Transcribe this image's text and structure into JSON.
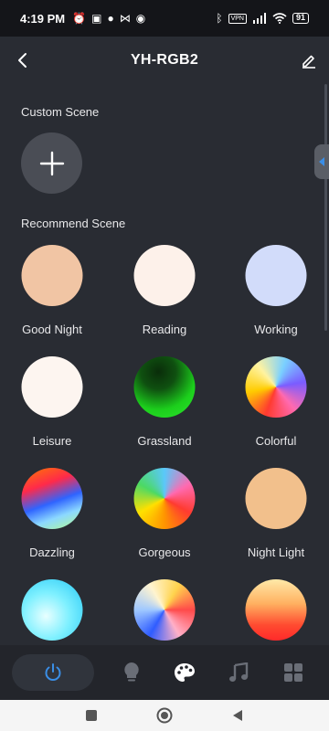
{
  "status_bar": {
    "time": "4:19 PM",
    "vpn": "VPN",
    "battery": "91"
  },
  "header": {
    "title": "YH-RGB2"
  },
  "custom_section": {
    "title": "Custom Scene"
  },
  "recommend_section": {
    "title": "Recommend Scene",
    "scenes": [
      {
        "label": "Good Night"
      },
      {
        "label": "Reading"
      },
      {
        "label": "Working"
      },
      {
        "label": "Leisure"
      },
      {
        "label": "Grassland"
      },
      {
        "label": "Colorful"
      },
      {
        "label": "Dazzling"
      },
      {
        "label": "Gorgeous"
      },
      {
        "label": "Night Light"
      },
      {
        "label": ""
      },
      {
        "label": ""
      },
      {
        "label": ""
      }
    ]
  },
  "tab_bar": {
    "tabs": [
      "power-icon",
      "bulb-icon",
      "palette-icon",
      "music-icon",
      "grid-icon"
    ],
    "active": "palette-icon",
    "accent": "#3a8ee6"
  }
}
